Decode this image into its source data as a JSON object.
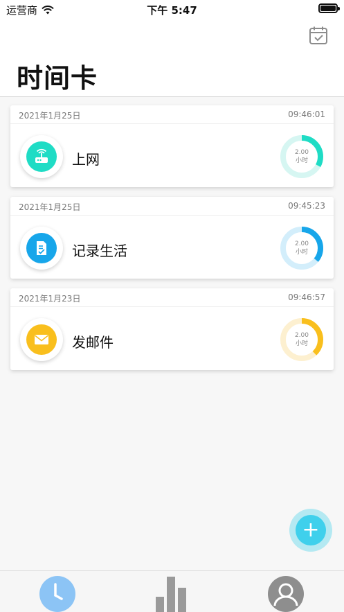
{
  "statusbar": {
    "carrier": "运营商",
    "time": "下午 5:47"
  },
  "header": {
    "title": "时间卡"
  },
  "cards": [
    {
      "date": "2021年1月25日",
      "time": "09:46:01",
      "title": "上网",
      "value": "2.00",
      "unit": "小时",
      "icon": "router-icon",
      "color": "#1fdcc5",
      "track": "#d6f6f2",
      "progress": 0.33
    },
    {
      "date": "2021年1月25日",
      "time": "09:45:23",
      "title": "记录生活",
      "value": "2.00",
      "unit": "小时",
      "icon": "document-icon",
      "color": "#17a6ea",
      "track": "#d3eefb",
      "progress": 0.36
    },
    {
      "date": "2021年1月23日",
      "time": "09:46:57",
      "title": "发邮件",
      "value": "2.00",
      "unit": "小时",
      "icon": "mail-icon",
      "color": "#f9bf1d",
      "track": "#fdf0d0",
      "progress": 0.38
    }
  ],
  "fab": {
    "label": "+"
  },
  "tabs": [
    {
      "icon": "clock-icon",
      "active": true
    },
    {
      "icon": "bar-chart-icon",
      "active": false
    },
    {
      "icon": "user-icon",
      "active": false
    }
  ]
}
